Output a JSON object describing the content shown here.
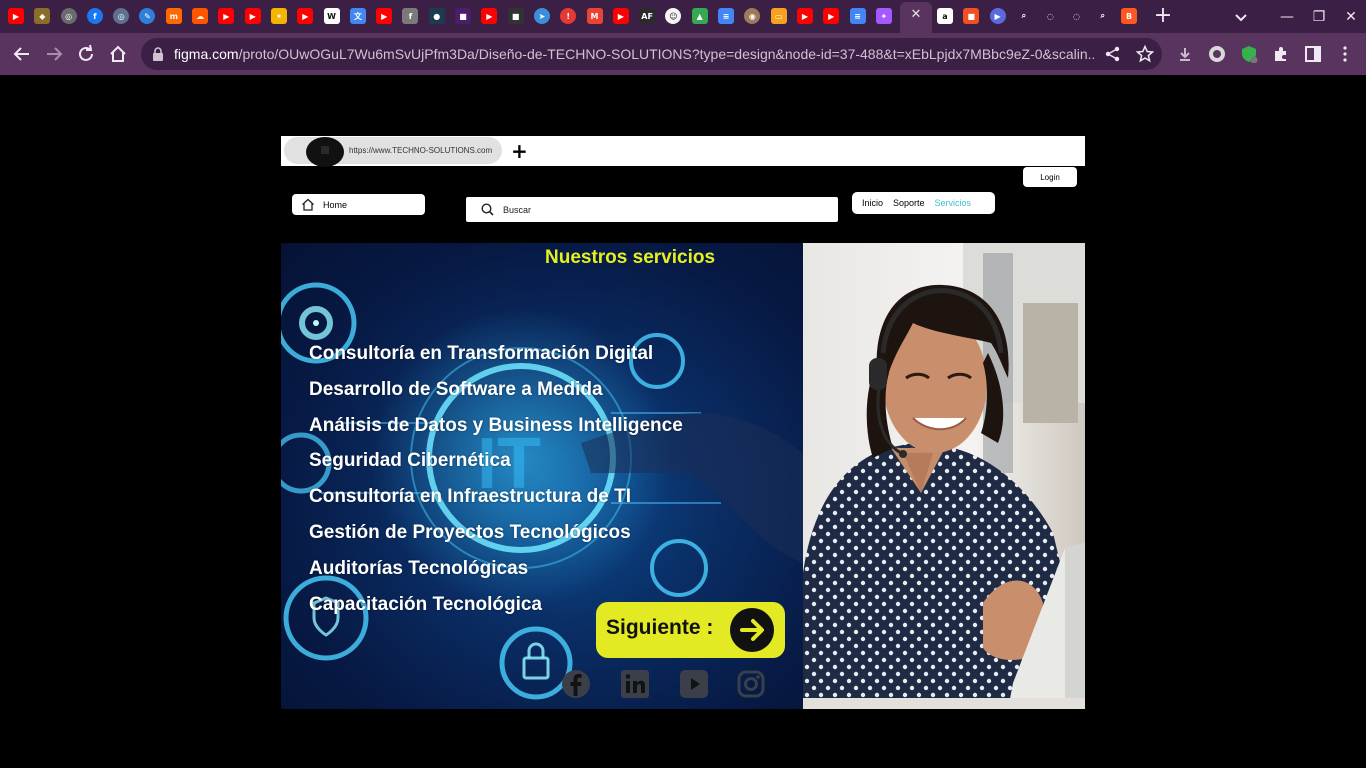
{
  "browser": {
    "tabs": {
      "favicons": [
        {
          "icon": "youtube-icon",
          "color": "#ff0000",
          "glyph": "▶",
          "round": false
        },
        {
          "icon": "shield-icon",
          "color": "#8a6d2b",
          "glyph": "◆",
          "round": false
        },
        {
          "icon": "globe-icon",
          "color": "#6b6b6b",
          "glyph": "◎",
          "round": true
        },
        {
          "icon": "facebook-icon",
          "color": "#1877f2",
          "glyph": "f",
          "round": true
        },
        {
          "icon": "globe-icon",
          "color": "#5f6f8f",
          "glyph": "◎",
          "round": true
        },
        {
          "icon": "pen-icon",
          "color": "#2f7ed8",
          "glyph": "✎",
          "round": true
        },
        {
          "icon": "mi-icon",
          "color": "#ff6900",
          "glyph": "m",
          "round": false
        },
        {
          "icon": "soundcloud-icon",
          "color": "#ff5500",
          "glyph": "☁",
          "round": false
        },
        {
          "icon": "youtube-icon",
          "color": "#ff0000",
          "glyph": "▶",
          "round": false
        },
        {
          "icon": "youtube-icon",
          "color": "#ff0000",
          "glyph": "▶",
          "round": false
        },
        {
          "icon": "star-icon",
          "color": "#f4b400",
          "glyph": "✶",
          "round": false
        },
        {
          "icon": "youtube-icon",
          "color": "#ff0000",
          "glyph": "▶",
          "round": false
        },
        {
          "icon": "wix-icon",
          "color": "#ffffff",
          "glyph": "W",
          "round": false
        },
        {
          "icon": "translate-icon",
          "color": "#4285f4",
          "glyph": "文",
          "round": false
        },
        {
          "icon": "youtube-icon",
          "color": "#ff0000",
          "glyph": "▶",
          "round": false
        },
        {
          "icon": "font-icon",
          "color": "#7a7a7a",
          "glyph": "f",
          "round": false
        },
        {
          "icon": "app-icon",
          "color": "#1d3b4f",
          "glyph": "●",
          "round": false
        },
        {
          "icon": "app-icon",
          "color": "#4b1d6b",
          "glyph": "■",
          "round": false
        },
        {
          "icon": "youtube-icon",
          "color": "#ff0000",
          "glyph": "▶",
          "round": false
        },
        {
          "icon": "video-icon",
          "color": "#333333",
          "glyph": "■",
          "round": false
        },
        {
          "icon": "bird-icon",
          "color": "#3b8fd9",
          "glyph": "➤",
          "round": true
        },
        {
          "icon": "alert-icon",
          "color": "#e53935",
          "glyph": "!",
          "round": true
        },
        {
          "icon": "gmail-icon",
          "color": "#ea4335",
          "glyph": "M",
          "round": false
        },
        {
          "icon": "youtube-icon",
          "color": "#ff0000",
          "glyph": "▶",
          "round": false
        },
        {
          "icon": "af-icon",
          "color": "#2b2b2b",
          "glyph": "AF",
          "round": false
        },
        {
          "icon": "emoji-icon",
          "color": "#f5f5f5",
          "glyph": "☺",
          "round": true
        },
        {
          "icon": "drive-icon",
          "color": "#34a853",
          "glyph": "▲",
          "round": false
        },
        {
          "icon": "docs-icon",
          "color": "#4285f4",
          "glyph": "≡",
          "round": false
        },
        {
          "icon": "chrome-icon",
          "color": "#9c7b5a",
          "glyph": "◉",
          "round": true
        },
        {
          "icon": "slides-icon",
          "color": "#f6a21e",
          "glyph": "▭",
          "round": false
        },
        {
          "icon": "youtube-icon",
          "color": "#ff0000",
          "glyph": "▶",
          "round": false
        },
        {
          "icon": "youtube-icon",
          "color": "#ff0000",
          "glyph": "▶",
          "round": false
        },
        {
          "icon": "docs-icon",
          "color": "#4285f4",
          "glyph": "≡",
          "round": false
        },
        {
          "icon": "figma-icon",
          "color": "#a259ff",
          "glyph": "✦",
          "round": false
        }
      ],
      "favicons_after": [
        {
          "icon": "amazon-icon",
          "color": "#ffffff",
          "glyph": "a",
          "round": false
        },
        {
          "icon": "microsoft-icon",
          "color": "#f25022",
          "glyph": "■",
          "round": false
        },
        {
          "icon": "play-icon",
          "color": "#5a6be0",
          "glyph": "▶",
          "round": true
        },
        {
          "icon": "search-icon",
          "color": "#3c1f45",
          "glyph": "⌕",
          "round": false
        },
        {
          "icon": "loading-icon",
          "color": "#3c1f45",
          "glyph": "◌",
          "round": true
        },
        {
          "icon": "loading-icon",
          "color": "#3c1f45",
          "glyph": "◌",
          "round": true
        },
        {
          "icon": "search-icon",
          "color": "#3c1f45",
          "glyph": "⌕",
          "round": false
        },
        {
          "icon": "blogger-icon",
          "color": "#ff5722",
          "glyph": "B",
          "round": false
        }
      ],
      "active_close": "✕",
      "new_tab": "+"
    },
    "window": {
      "minimize": "—",
      "restore": "❐",
      "close": "✕"
    },
    "address": {
      "host": "figma.com",
      "path": "/proto/OUwOGuL7Wu6mSvUjPfm3Da/Diseño-de-TECHNO-SOLUTIONS?type=design&node-id=37-488&t=xEbLpjdx7MBbc9eZ-0&scalin..."
    }
  },
  "prototype": {
    "tab_url": "https://www.TECHNO-SOLUTIONS.com",
    "tab_plus": "+",
    "login": "Login",
    "home": "Home",
    "search_placeholder": "Buscar",
    "nav": [
      "Inicio",
      "Soporte",
      "Servicios"
    ],
    "nav_current": "Servicios",
    "hero_title": "Nuestros servicios",
    "services": [
      "Consultoría en Transformación Digital",
      "Desarrollo de Software a Medida",
      "Análisis de Datos y Business Intelligence",
      "Seguridad Cibernética",
      "Consultoría en Infraestructura de TI",
      "Gestión de Proyectos Tecnológicos",
      "Auditorías Tecnológicas",
      "Capacitación Tecnológica"
    ],
    "hero_watermark": "IT",
    "next_button": "Siguiente :",
    "social": [
      "facebook",
      "linkedin",
      "youtube",
      "instagram"
    ],
    "colors": {
      "accent_yellow": "#e3ea23",
      "nav_active": "#3fc1c9",
      "hero_blue": "#0a2e66"
    }
  }
}
